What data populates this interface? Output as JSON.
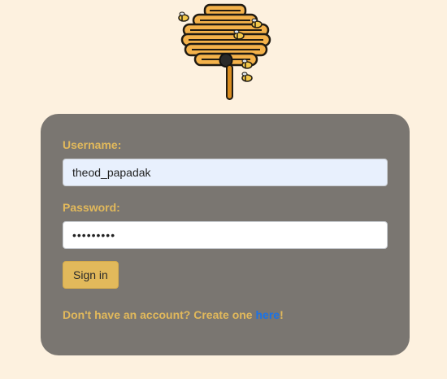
{
  "logo": {
    "icon": "beehive-icon"
  },
  "form": {
    "username_label": "Username:",
    "username_value": "theod_papadak",
    "password_label": "Password:",
    "password_value": "•••••••••",
    "signin_label": "Sign in"
  },
  "signup": {
    "prefix": "Don't have an account? Create one ",
    "link_text": "here",
    "suffix": "!"
  },
  "colors": {
    "page_bg": "#fdf1df",
    "card_bg": "#7a7671",
    "accent": "#e2b95b",
    "link": "#1a73e8"
  }
}
